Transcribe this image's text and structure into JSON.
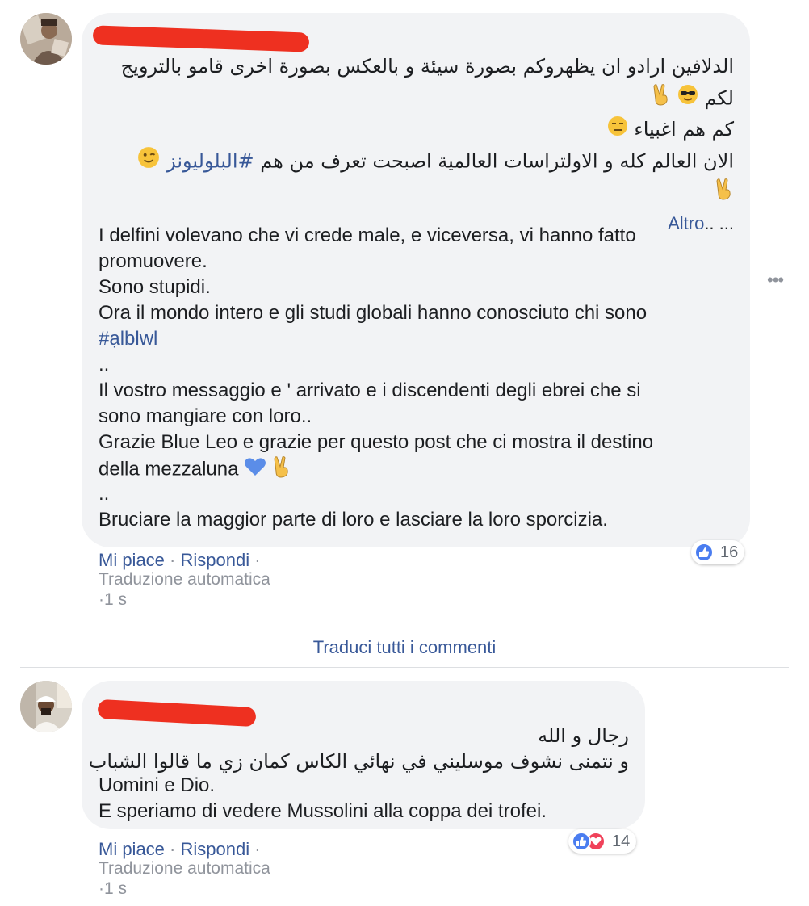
{
  "comments": [
    {
      "arabic_lines": [
        "الدلافين ارادو ان يظهروكم بصورة سيئة و بالعكس بصورة اخرى قامو بالترويج",
        "لكم",
        "كم هم اغبياء",
        "الان العالم كله و الاولتراسات العالمية اصبحت تعرف من هم",
        ""
      ],
      "arabic_hashtag": "#البلوليونز",
      "see_more_dots": ".. ...",
      "see_more": "Altro",
      "translation_lines": [
        "I delfini volevano che vi crede male, e viceversa, vi hanno fatto",
        "promuovere.",
        "Sono stupidi.",
        "Ora il mondo intero e gli studi globali hanno conosciuto chi sono"
      ],
      "translation_hashtag": "#ạlblwl",
      "translation_lines_2": [
        "..",
        "Il vostro messaggio e ' arrivato e i discendenti degli ebrei che si",
        "sono mangiare con loro..",
        "Grazie Blue Leo e grazie per questo post che ci mostra il destino",
        "della mezzaluna"
      ],
      "translation_lines_3": [
        "..",
        "Bruciare la maggior parte di loro e lasciare la loro sporcizia."
      ],
      "like": "Mi piace",
      "reply": "Rispondi",
      "auto_translation": "Traduzione automatica",
      "time": "1 s",
      "reaction_count": "16"
    },
    {
      "arabic_lines": [
        "رجال و الله",
        "و نتمنى نشوف موسليني في نهائي الكاس كمان زي ما قالوا الشباب"
      ],
      "translation_lines": [
        "Uomini e Dio.",
        "E speriamo di vedere Mussolini alla coppa dei trofei."
      ],
      "like": "Mi piace",
      "reply": "Rispondi",
      "auto_translation": "Traduzione automatica",
      "time": "1 s",
      "reaction_count": "14"
    }
  ],
  "translate_all": "Traduci tutti i commenti",
  "separator": "·",
  "icons": {
    "sunglasses": "sunglasses-emoji",
    "victory": "victory-hand-emoji",
    "expressionless": "expressionless-emoji",
    "wink": "wink-emoji",
    "blue_heart": "blue-heart-emoji",
    "like_reaction": "like-reaction-icon",
    "love_reaction": "love-reaction-icon",
    "more": "more-options-icon"
  },
  "colors": {
    "link": "#385898",
    "bubble": "#f2f3f5",
    "meta": "#90949c",
    "redaction": "#ee3020"
  }
}
